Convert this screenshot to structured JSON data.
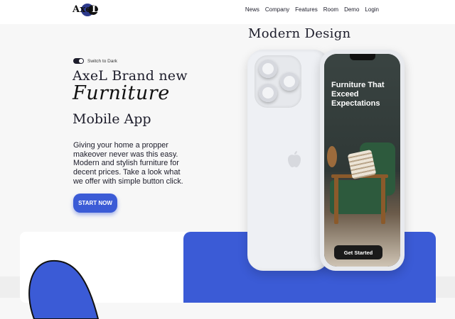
{
  "header": {
    "logo_text_a": "Axe",
    "logo_text_b": "L",
    "nav": [
      "News",
      "Company",
      "Features",
      "Room",
      "Demo",
      "Login"
    ]
  },
  "hero": {
    "toggle_label": "Switch to Dark",
    "heading_line1": "AxeL Brand new",
    "heading_script": "Furniture",
    "heading_line3": "Mobile App",
    "paragraph": "Giving your home a propper makeover never was this easy. Modern and stylish furniture for decent prices. Take a look what we offer with simple button click.",
    "cta_label": "START NOW"
  },
  "showcase": {
    "title": "Modern Design",
    "screen_title": "Furniture That Exceed Expectations",
    "screen_button": "Get Started"
  },
  "colors": {
    "accent": "#3b5bd6",
    "text": "#1d1d2b",
    "chair": "#2d5a3d"
  }
}
